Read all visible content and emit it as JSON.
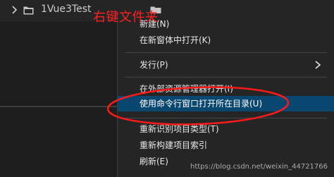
{
  "explorer": {
    "folder_name": "1Vue3Test",
    "chevron_icon": "chevron-right-icon",
    "folder_icon": "folder-icon"
  },
  "context_menu": {
    "items": [
      {
        "label": "新建(N)",
        "submenu": false
      },
      {
        "label": "在新窗体中打开(K)",
        "submenu": false
      },
      {
        "label": "发行(P)",
        "submenu": true
      },
      {
        "label": "在外部资源管理器打开(I)",
        "submenu": false
      },
      {
        "label": "使用命令行窗口打开所在目录(U)",
        "submenu": false,
        "highlighted": true
      },
      {
        "label": "重新识别项目类型(T)",
        "submenu": false
      },
      {
        "label": "重新构建项目索引",
        "submenu": false
      },
      {
        "label": "刷新(E)",
        "submenu": false
      }
    ]
  },
  "annotation": {
    "text": "右键文件夹",
    "color": "#ff2020"
  },
  "watermark": "https://blog.csdn.net/weixin_44721766",
  "colors": {
    "menu_bg": "#252526",
    "highlight": "#094771",
    "text": "#e8e8e8"
  }
}
